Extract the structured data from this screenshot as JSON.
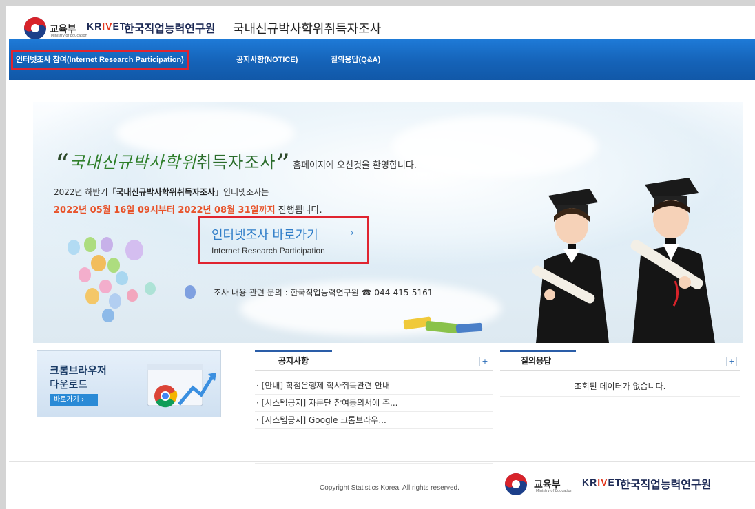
{
  "header": {
    "gov_name": "교육부",
    "gov_sub": "Ministry of Education",
    "krivet_prefix": "KR",
    "krivet_v": "IV",
    "krivet_suffix": "ET",
    "institute": "한국직업능력연구원",
    "site_title": "국내신규박사학위취득자조사"
  },
  "nav": {
    "items": [
      {
        "label": "인터넷조사 참여(Internet Research Participation)"
      },
      {
        "label": "공지사항(NOTICE)"
      },
      {
        "label": "질의응답(Q&A)"
      }
    ]
  },
  "hero": {
    "open_quote": "“",
    "survey_name_a": "국내신규박사학위",
    "survey_name_b": "취득자조사",
    "close_quote": "”",
    "welcome_suffix": "홈페이지에 오신것을 환영합니다.",
    "period_prefix": "2022년 하반기「",
    "period_survey": "국내신규박사학위취득자조사",
    "period_suffix": "」인터넷조사는",
    "schedule_red": "2022년 05월 16일 09시부터 2022년 08월 31일까지",
    "schedule_suffix": " 진행됩니다.",
    "cta_ko": "인터넷조사 바로가기",
    "cta_arrow": "›",
    "cta_en": "Internet Research Participation",
    "contact": "조사 내용 관련 문의 : 한국직업능력연구원  ☎ 044-415-5161"
  },
  "chrome": {
    "title": "크롬브라우저",
    "subtitle": "다운로드",
    "button": "바로가기 ›"
  },
  "notice": {
    "tab": "공지사항",
    "more": "+",
    "items": [
      "· [안내] 학점은행제 학사취득관련 안내",
      "· [시스템공지] 자문단 참여동의서에 주...",
      "· [시스템공지] Google 크롬브라우..."
    ]
  },
  "qna": {
    "tab": "질의응답",
    "more": "+",
    "empty": "조회된 데이터가 없습니다."
  },
  "footer": {
    "copyright": "Copyright Statistics Korea. All rights reserved.",
    "gov_name": "교육부",
    "gov_sub": "Ministry of Education",
    "krivet_prefix": "KR",
    "krivet_v": "IV",
    "krivet_suffix": "ET",
    "institute": "한국직업능력연구원"
  },
  "colors": {
    "nav_blue": "#1563b8",
    "highlight_red": "#e02430",
    "schedule_orange": "#e8532a",
    "cta_blue": "#2f7dc8"
  }
}
